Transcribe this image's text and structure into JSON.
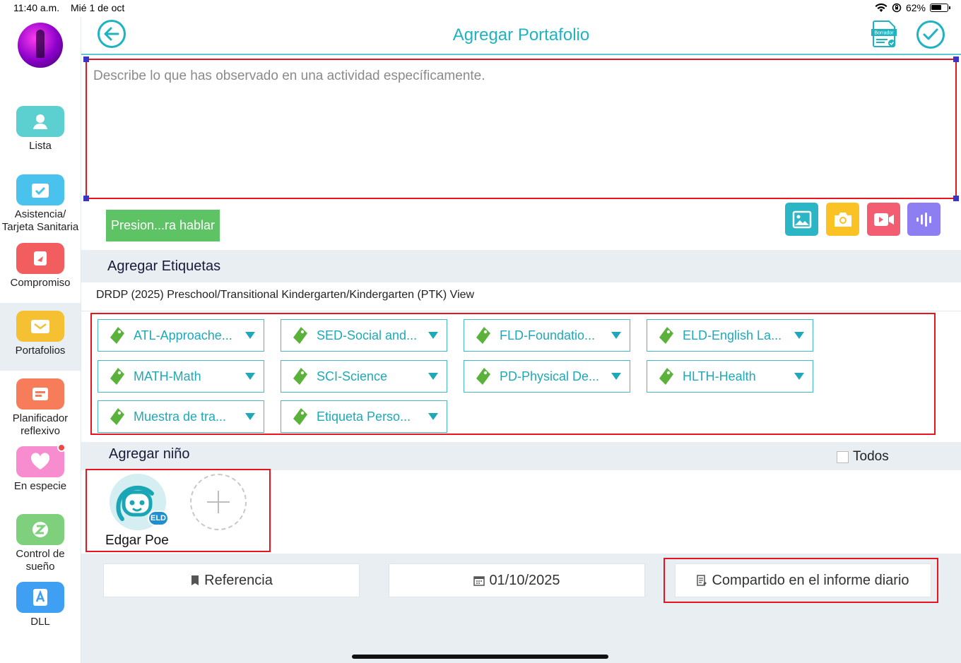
{
  "status_bar": {
    "time": "11:40 a.m.",
    "date": "Mié 1 de oct",
    "battery": "62%"
  },
  "sidebar": {
    "items": [
      {
        "label": "Lista",
        "icon": "user-icon",
        "color": "#5ccfd1"
      },
      {
        "label": "Asistencia/ Tarjeta Sanitaria",
        "icon": "calendar-check-icon",
        "color": "#49c3ee"
      },
      {
        "label": "Compromiso",
        "icon": "engagement-icon",
        "color": "#f25d5f"
      },
      {
        "label": "Portafolios",
        "icon": "portfolio-icon",
        "color": "#f5c132"
      },
      {
        "label": "Planificador reflexivo",
        "icon": "planner-icon",
        "color": "#f77d5a"
      },
      {
        "label": "En especie",
        "icon": "heart-icon",
        "color": "#f78ccf"
      },
      {
        "label": "Control de sueño",
        "icon": "sleep-icon",
        "color": "#7fd07d"
      },
      {
        "label": "DLL",
        "icon": "dll-icon",
        "color": "#3f9ff2"
      }
    ]
  },
  "header": {
    "title": "Agregar Portafolio",
    "draft_label": "Borrador"
  },
  "description": {
    "placeholder": "Describe lo que has observado en una actividad específicamente.",
    "value": ""
  },
  "speak_button": {
    "label": "Presion...ra hablar"
  },
  "tags": {
    "title": "Agregar Etiquetas",
    "framework": "DRDP (2025) Preschool/Transitional Kindergarten/Kindergarten (PTK) View",
    "dropdowns": [
      "ATL-Approache...",
      "SED-Social and...",
      "FLD-Foundatio...",
      "ELD-English La...",
      "MATH-Math",
      "SCI-Science",
      "PD-Physical De...",
      "HLTH-Health",
      "Muestra de tra...",
      "Etiqueta Perso..."
    ]
  },
  "children": {
    "title": "Agregar niño",
    "all_label": "Todos",
    "list": [
      {
        "name": "Edgar Poe",
        "badge": "ELD"
      }
    ]
  },
  "footer": {
    "reference_label": "Referencia",
    "date": "01/10/2025",
    "share_label": "Compartido en el informe diario"
  },
  "colors": {
    "accent": "#1fb3c1",
    "tag_green": "#5ab23a",
    "speak_green": "#5ec364",
    "highlight_red": "#e8141e"
  }
}
